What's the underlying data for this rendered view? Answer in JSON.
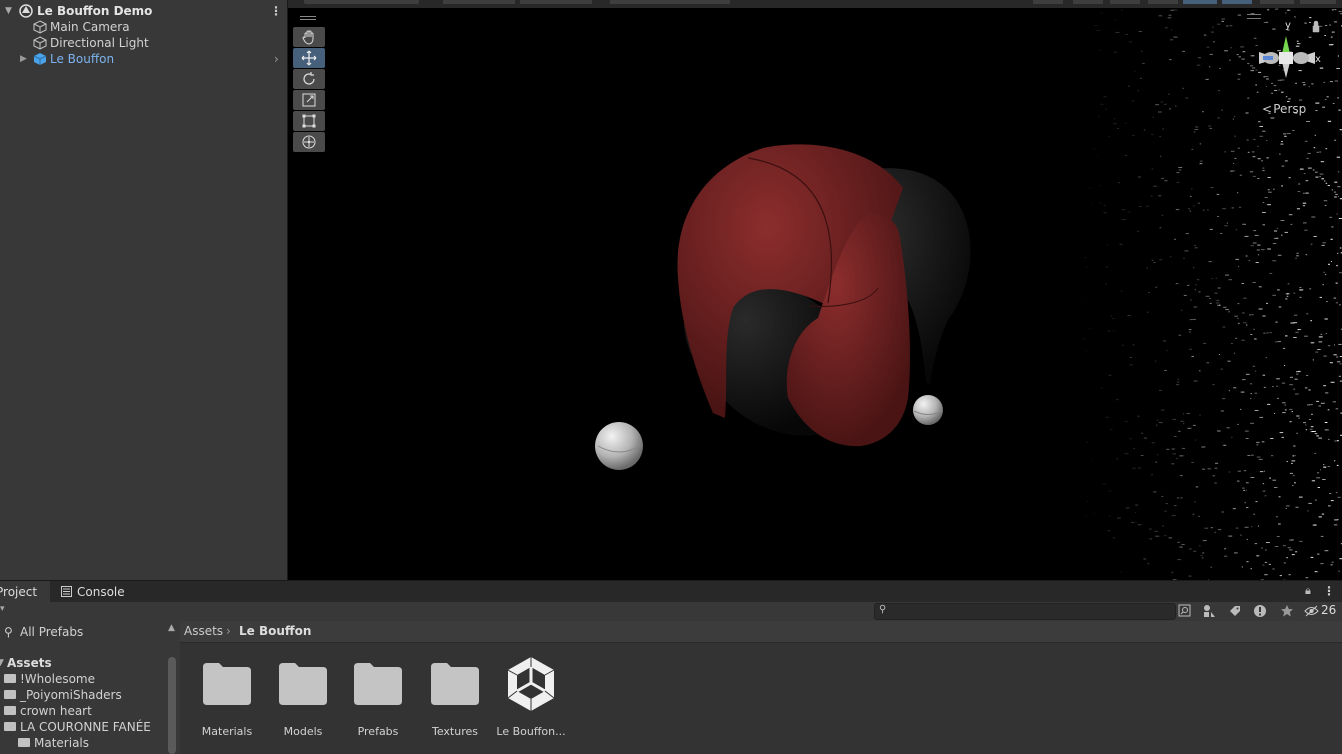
{
  "hierarchy": {
    "scene_name": "Le Bouffon Demo",
    "items": [
      {
        "label": "Main Camera",
        "icon": "gameobject-icon"
      },
      {
        "label": "Directional Light",
        "icon": "gameobject-icon"
      },
      {
        "label": "Le Bouffon",
        "icon": "prefab-icon",
        "selected_color": "#7cb3f0"
      }
    ]
  },
  "scene": {
    "gizmo_y": "y",
    "gizmo_x": "x",
    "projection": "Persp",
    "tools": [
      "hand-tool",
      "move-tool",
      "rotate-tool",
      "scale-tool",
      "rect-tool",
      "transform-tool"
    ],
    "active_tool": "move-tool"
  },
  "project": {
    "tabs": [
      "Project",
      "Console"
    ],
    "search_placeholder": "",
    "hidden_count": "26",
    "favorites": "All Prefabs",
    "assets_root": "Assets",
    "tree": [
      "!Wholesome",
      "_PoiyomiShaders",
      "crown heart",
      "LA COURONNE FANÉE",
      "Materials"
    ],
    "breadcrumb_root": "Assets",
    "breadcrumb_current": "Le Bouffon",
    "items": [
      {
        "label": "Materials",
        "type": "folder"
      },
      {
        "label": "Models",
        "type": "folder"
      },
      {
        "label": "Prefabs",
        "type": "folder"
      },
      {
        "label": "Textures",
        "type": "folder"
      },
      {
        "label": "Le Bouffon...",
        "type": "unity-scene"
      }
    ]
  },
  "colors": {
    "accent_blue": "#46607c",
    "hat_red": "#7a2424",
    "hat_black": "#141414"
  }
}
